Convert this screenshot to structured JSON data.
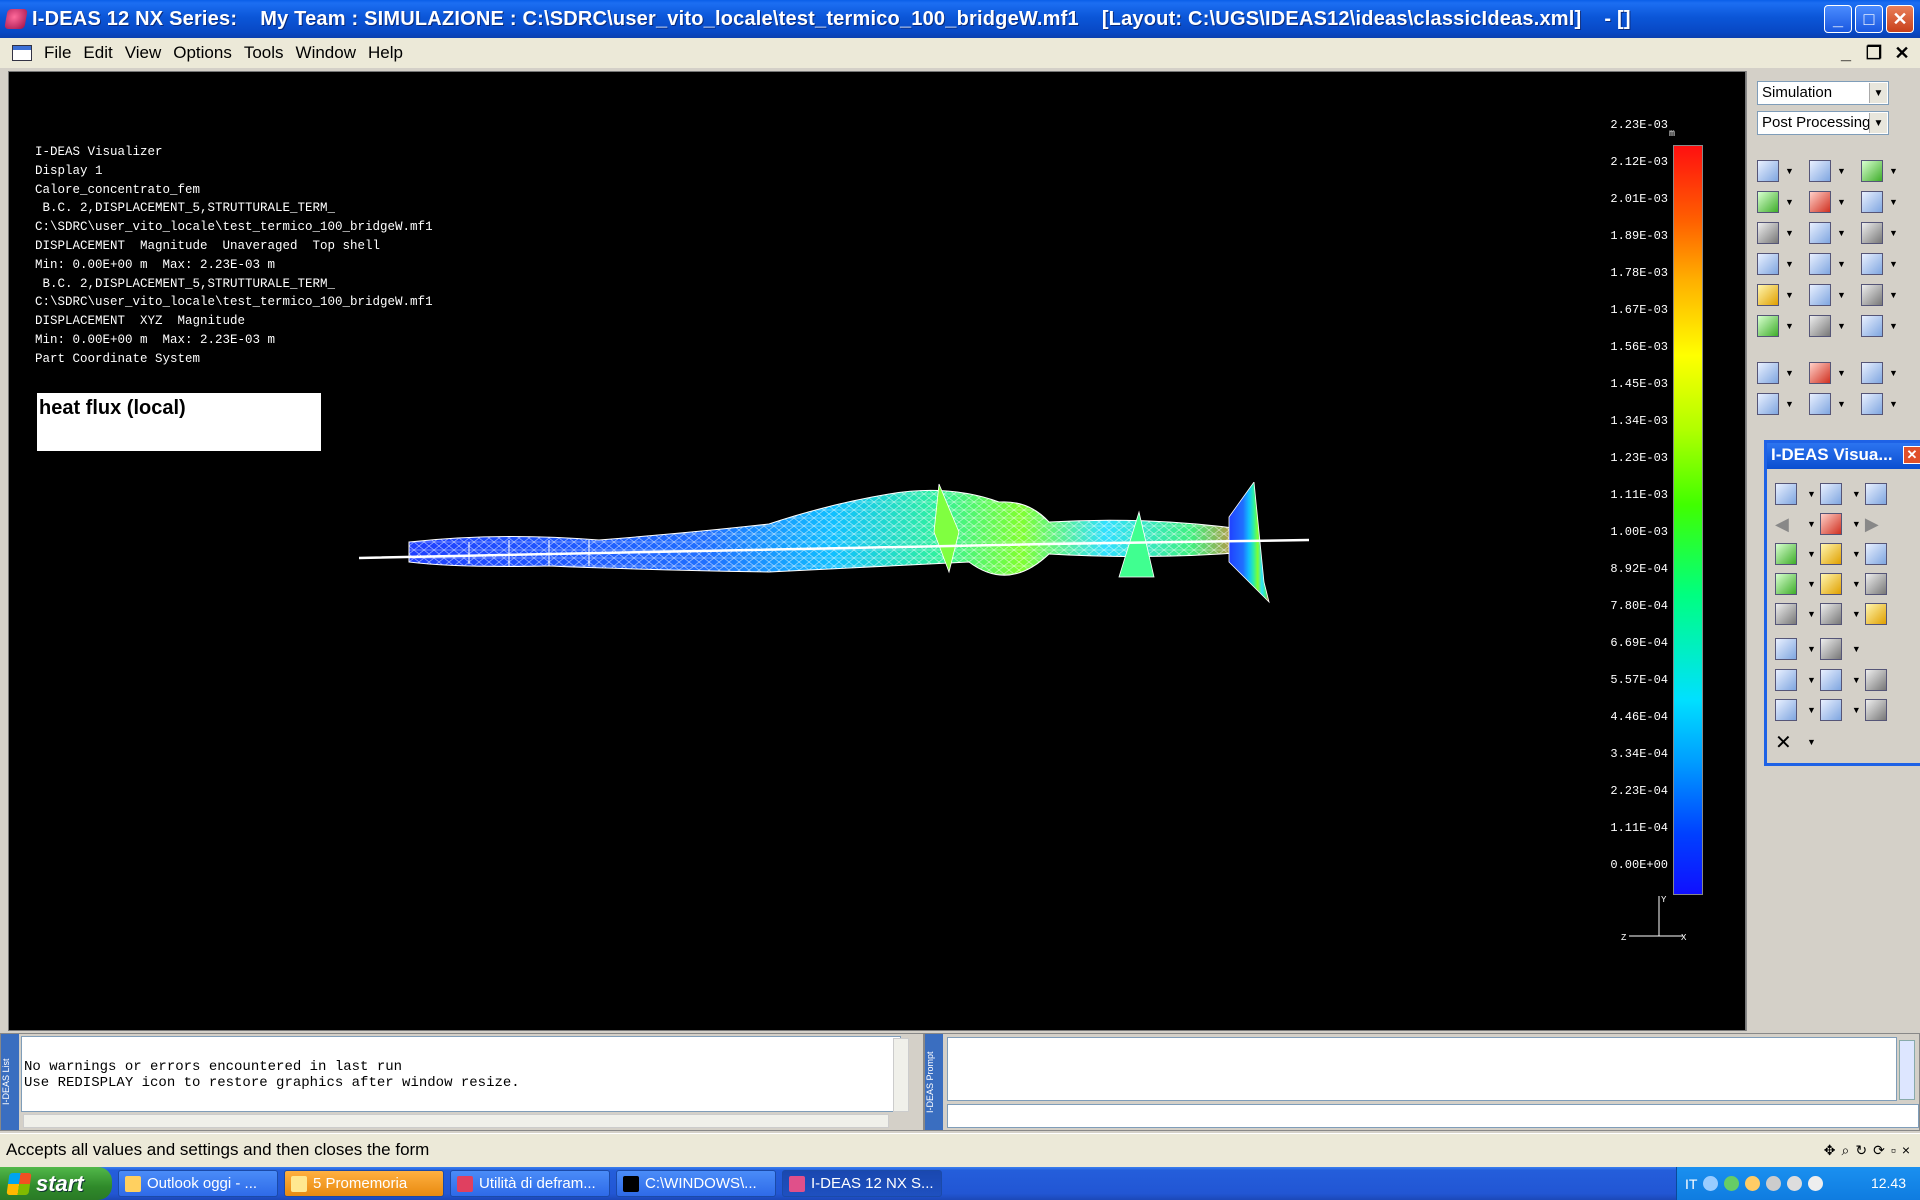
{
  "window": {
    "title": "I-DEAS 12 NX Series:    My Team : SIMULAZIONE : C:\\SDRC\\user_vito_locale\\test_termico_100_bridgeW.mf1    [Layout: C:\\UGS\\IDEAS12\\ideas\\classicIdeas.xml]    - []"
  },
  "menu": {
    "items": [
      "File",
      "Edit",
      "View",
      "Options",
      "Tools",
      "Window",
      "Help"
    ]
  },
  "viz_info": {
    "lines": [
      "I-DEAS Visualizer",
      "Display 1",
      "Calore_concentrato_fem",
      " B.C. 2,DISPLACEMENT_5,STRUTTURALE_TERM_",
      "C:\\SDRC\\user_vito_locale\\test_termico_100_bridgeW.mf1",
      "DISPLACEMENT  Magnitude  Unaveraged  Top shell",
      "Min: 0.00E+00 m  Max: 2.23E-03 m",
      " B.C. 2,DISPLACEMENT_5,STRUTTURALE_TERM_",
      "C:\\SDRC\\user_vito_locale\\test_termico_100_bridgeW.mf1",
      "DISPLACEMENT  XYZ  Magnitude",
      "Min: 0.00E+00 m  Max: 2.23E-03 m",
      "Part Coordinate System"
    ]
  },
  "annotation": {
    "label": "heat flux (local)"
  },
  "legend": {
    "unit": "m",
    "ticks": [
      "2.23E-03",
      "2.12E-03",
      "2.01E-03",
      "1.89E-03",
      "1.78E-03",
      "1.67E-03",
      "1.56E-03",
      "1.45E-03",
      "1.34E-03",
      "1.23E-03",
      "1.11E-03",
      "1.00E-03",
      "8.92E-04",
      "7.80E-04",
      "6.69E-04",
      "5.57E-04",
      "4.46E-04",
      "3.34E-04",
      "2.23E-04",
      "1.11E-04",
      "0.00E+00"
    ]
  },
  "triad": {
    "y": "Y",
    "x": "X",
    "z": "Z"
  },
  "right_panel": {
    "task_select": "Simulation",
    "subtask_select": "Post Processing"
  },
  "palette": {
    "title": "I-DEAS Visua..."
  },
  "list_pane": {
    "tab_label": "I-DEAS List",
    "lines": [
      "No warnings or errors encountered in last run",
      "Use REDISPLAY icon to restore graphics after window resize."
    ]
  },
  "prompt_pane": {
    "tab_label": "I-DEAS Prompt",
    "input_value": ""
  },
  "status": {
    "text": "Accepts all values and settings and then closes the form"
  },
  "taskbar": {
    "start_label": "start",
    "tasks": [
      "Outlook oggi - ...",
      "5 Promemoria",
      "Utilità di defram...",
      "C:\\WINDOWS\\...",
      "I-DEAS 12 NX S..."
    ],
    "language": "IT",
    "clock": "12.43"
  },
  "colors": {
    "titlebar": "#0848c4",
    "graphics_bg": "#000000",
    "mesh_low": "#1010ff",
    "mesh_high": "#ff1010"
  }
}
